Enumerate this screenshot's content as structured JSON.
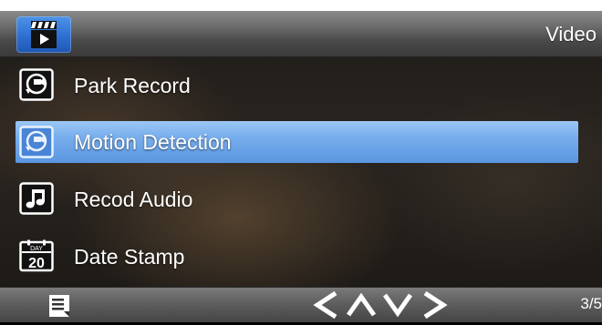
{
  "header": {
    "title": "Video",
    "mode_icon": "video-mode-icon"
  },
  "menu": {
    "items": [
      {
        "label": "Park Record",
        "icon": "park-record-icon",
        "selected": false
      },
      {
        "label": "Motion Detection",
        "icon": "motion-detection-icon",
        "selected": true
      },
      {
        "label": "Recod Audio",
        "icon": "music-note-icon",
        "selected": false
      },
      {
        "label": "Date Stamp",
        "icon": "calendar-icon",
        "selected": false,
        "icon_text": {
          "top": "DAY",
          "number": "20"
        }
      }
    ]
  },
  "footer": {
    "menu_icon": "list-menu-icon",
    "nav": [
      "chevron-left-icon",
      "chevron-up-icon",
      "chevron-down-icon",
      "chevron-right-icon"
    ],
    "page_indicator": "3/5"
  },
  "colors": {
    "selection": "#6aa6ea",
    "header_icon_blue": "#2e6fd1",
    "text": "#ffffff"
  }
}
